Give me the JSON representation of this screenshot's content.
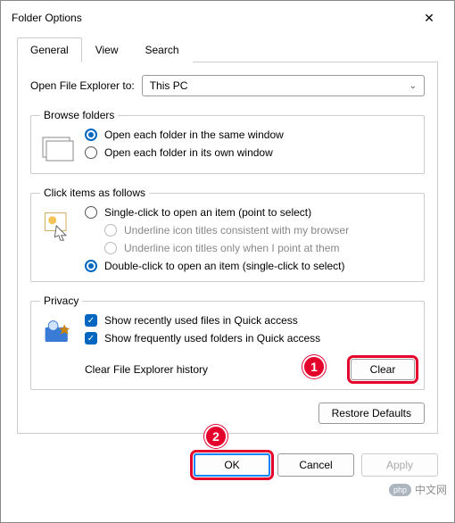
{
  "window": {
    "title": "Folder Options"
  },
  "tabs": {
    "general": "General",
    "view": "View",
    "search": "Search"
  },
  "openExplorer": {
    "label": "Open File Explorer to:",
    "value": "This PC"
  },
  "browse": {
    "legend": "Browse folders",
    "same": "Open each folder in the same window",
    "own": "Open each folder in its own window"
  },
  "click": {
    "legend": "Click items as follows",
    "single": "Single-click to open an item (point to select)",
    "u1": "Underline icon titles consistent with my browser",
    "u2": "Underline icon titles only when I point at them",
    "double": "Double-click to open an item (single-click to select)"
  },
  "privacy": {
    "legend": "Privacy",
    "recent": "Show recently used files in Quick access",
    "frequent": "Show frequently used folders in Quick access",
    "clearLabel": "Clear File Explorer history",
    "clearBtn": "Clear"
  },
  "restore": "Restore Defaults",
  "footer": {
    "ok": "OK",
    "cancel": "Cancel",
    "apply": "Apply"
  },
  "annot": {
    "b1": "1",
    "b2": "2"
  },
  "watermark": {
    "logo": "php",
    "text": "中文网"
  }
}
